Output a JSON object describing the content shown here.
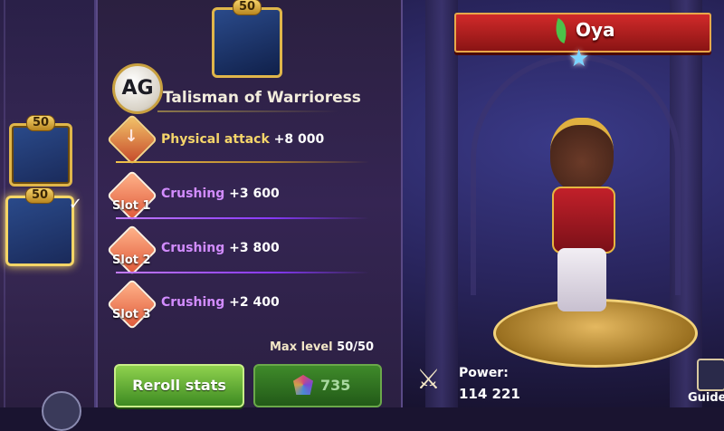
{
  "item": {
    "name": "Talisman of Warrioress",
    "level_badge": "50",
    "logo_text": "AG",
    "max_level_label": "Max level",
    "max_level_value": "50/50"
  },
  "left_strip": {
    "slots": [
      {
        "level": "50",
        "icon": "helmet-icon",
        "selected": false
      },
      {
        "level": "50",
        "icon": "talisman-icon",
        "selected": true,
        "check": "✓"
      }
    ]
  },
  "stats": {
    "main": {
      "name": "Physical attack",
      "value": "+8 000",
      "icon": "sword-stat-icon"
    },
    "slots": [
      {
        "label": "Slot 1",
        "name": "Crushing",
        "value": "+3 600",
        "icon": "crushing-icon"
      },
      {
        "label": "Slot 2",
        "name": "Crushing",
        "value": "+3 800",
        "icon": "crushing-icon"
      },
      {
        "label": "Slot 3",
        "name": "Crushing",
        "value": "+2 400",
        "icon": "crushing-icon"
      }
    ]
  },
  "buttons": {
    "reroll_label": "Reroll stats",
    "cost_value": "735",
    "cost_icon": "gem-icon"
  },
  "hero": {
    "name": "Oya",
    "element_icon": "leaf-icon",
    "star_icon": "star-icon",
    "star_glyph": "★",
    "power_label": "Power:",
    "power_value": "114 221",
    "power_icon": "crossed-swords-icon",
    "power_glyph": "⚔"
  },
  "guide_label": "Guide",
  "colors": {
    "accent_gold": "#e0b64a",
    "banner_red": "#c02020",
    "reroll_green": "#5fae34",
    "crushing_purple": "#d28cff"
  }
}
